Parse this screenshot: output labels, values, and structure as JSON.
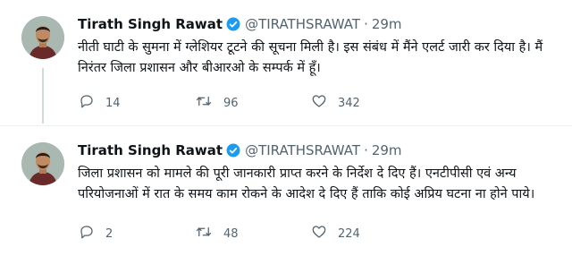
{
  "tweets": [
    {
      "author_name": "Tirath Singh Rawat",
      "handle": "@TIRATHSRAWAT",
      "separator": "·",
      "time": "29m",
      "text": "नीती घाटी के सुमना में ग्लेशियर टूटने की सूचना मिली है। इस संबंध में मैंने एलर्ट जारी कर दिया है। मैं निरंतर जिला प्रशासन और बीआरओ के सम्पर्क में हूँ।",
      "replies": "14",
      "retweets": "96",
      "likes": "342"
    },
    {
      "author_name": "Tirath Singh Rawat",
      "handle": "@TIRATHSRAWAT",
      "separator": "·",
      "time": "29m",
      "text": "जिला प्रशासन को मामले की पूरी जानकारी प्राप्त करने के निर्देश दे दिए हैं। एनटीपीसी एवं अन्य परियोजनाओं में रात के समय काम रोकने के आदेश दे दिए हैं ताकि कोई अप्रिय घटना ना होने पाये।",
      "replies": "2",
      "retweets": "48",
      "likes": "224"
    }
  ],
  "icons": {
    "verified": "verified-badge-icon",
    "reply": "reply-icon",
    "retweet": "retweet-icon",
    "like": "heart-icon"
  },
  "colors": {
    "verified": "#1d9bf0",
    "secondary_text": "#536471",
    "thread_line": "#cfd9de"
  }
}
